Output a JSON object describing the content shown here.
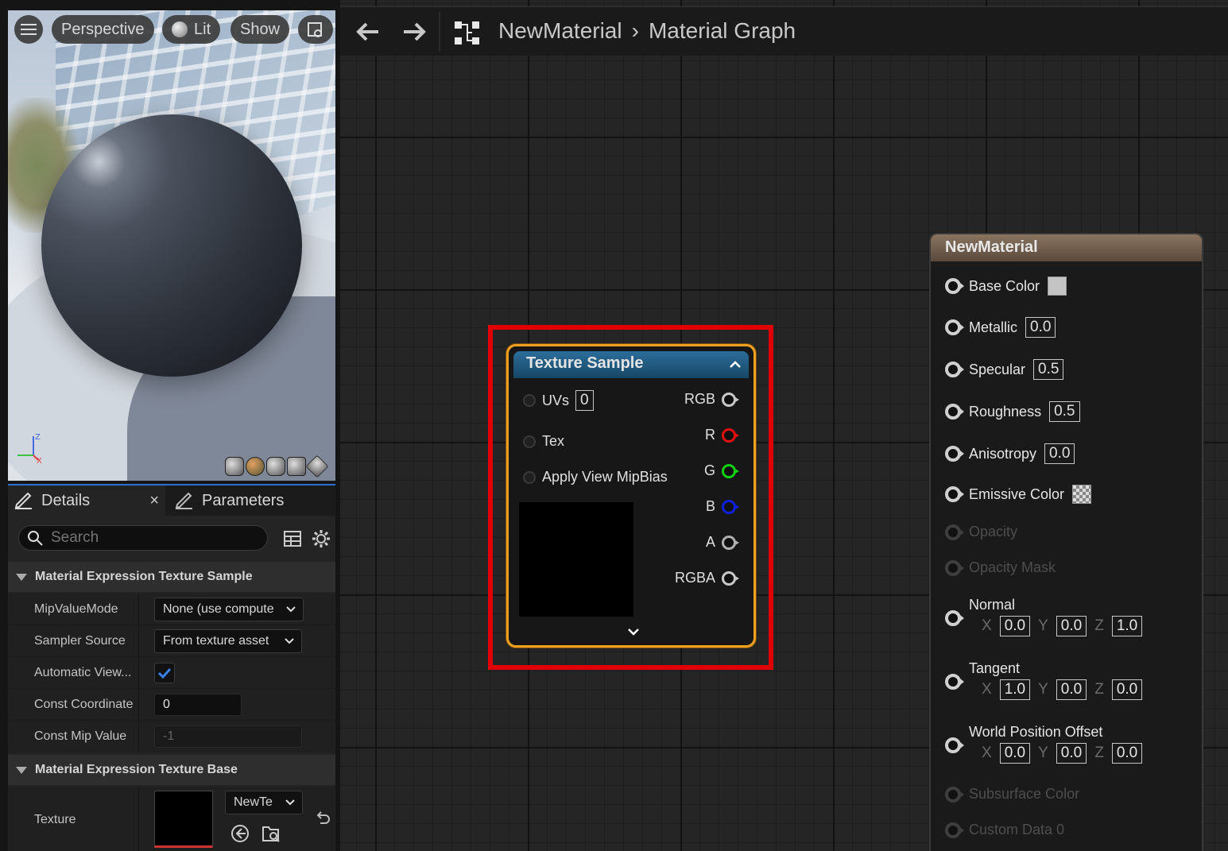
{
  "viewport": {
    "menu_icon": "hamburger-icon",
    "view_mode": "Perspective",
    "lighting": "Lit",
    "show": "Show",
    "axis": {
      "z": "Z",
      "x": "X"
    }
  },
  "details": {
    "tab_details": "Details",
    "tab_close": "×",
    "tab_parameters": "Parameters",
    "search_placeholder": "Search",
    "section_sample": "Material Expression Texture Sample",
    "props": [
      {
        "label": "MipValueMode",
        "value": "None (use compute"
      },
      {
        "label": "Sampler Source",
        "value": "From texture asset"
      },
      {
        "label": "Automatic View...",
        "checked": true
      },
      {
        "label": "Const Coordinate",
        "value": "0"
      },
      {
        "label": "Const Mip Value",
        "value": "-1"
      }
    ],
    "section_base": "Material Expression Texture Base",
    "texture_label": "Texture",
    "texture_value": "NewTe"
  },
  "graph": {
    "breadcrumb_1": "NewMaterial",
    "breadcrumb_sep": "›",
    "breadcrumb_2": "Material Graph"
  },
  "texture_node": {
    "title": "Texture Sample",
    "inputs": [
      "UVs",
      "Tex",
      "Apply View MipBias"
    ],
    "uvs_value": "0",
    "outputs": [
      {
        "label": "RGB",
        "color": "#c8c8c8"
      },
      {
        "label": "R",
        "color": "#e01010"
      },
      {
        "label": "G",
        "color": "#10d010"
      },
      {
        "label": "B",
        "color": "#1020e0"
      },
      {
        "label": "A",
        "color": "#b0b0b0"
      },
      {
        "label": "RGBA",
        "color": "#c8c8c8"
      }
    ]
  },
  "material_node": {
    "title": "NewMaterial",
    "base_color": "Base Color",
    "metallic": "Metallic",
    "metallic_value": "0.0",
    "specular": "Specular",
    "specular_value": "0.5",
    "roughness": "Roughness",
    "roughness_value": "0.5",
    "anisotropy": "Anisotropy",
    "anisotropy_value": "0.0",
    "emissive": "Emissive Color",
    "opacity": "Opacity",
    "opacity_mask": "Opacity Mask",
    "normal": "Normal",
    "normal_xyz": [
      "0.0",
      "0.0",
      "1.0"
    ],
    "tangent": "Tangent",
    "tangent_xyz": [
      "1.0",
      "0.0",
      "0.0"
    ],
    "wpo": "World Position Offset",
    "wpo_xyz": [
      "0.0",
      "0.0",
      "0.0"
    ],
    "subsurface": "Subsurface Color",
    "custom_data": "Custom Data 0",
    "axis_x": "X",
    "axis_y": "Y",
    "axis_z": "Z"
  }
}
